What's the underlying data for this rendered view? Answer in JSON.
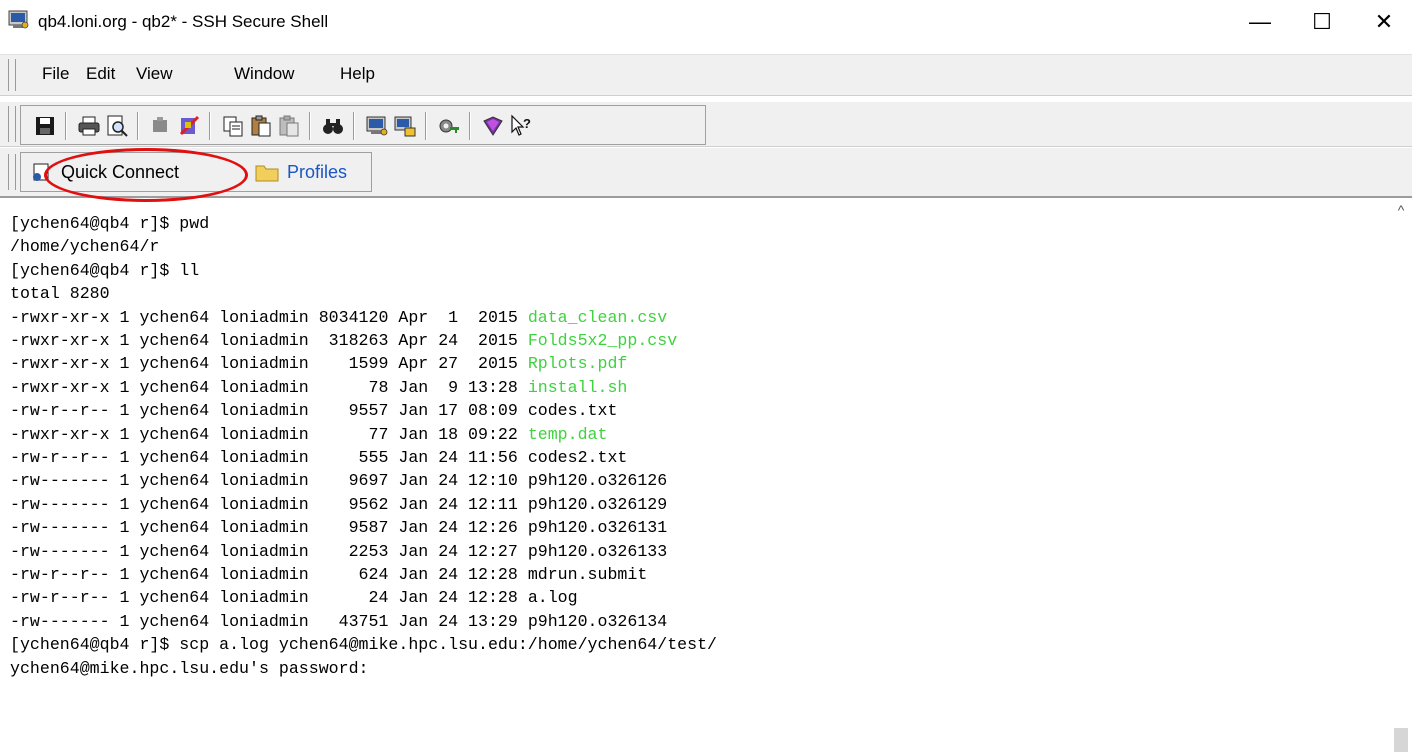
{
  "window": {
    "title": "qb4.loni.org - qb2* - SSH Secure Shell",
    "minimize_glyph": "—",
    "maximize_glyph": "☐",
    "close_glyph": "✕"
  },
  "menu": [
    "File",
    "Edit",
    "View",
    "Window",
    "Help"
  ],
  "toolbar_icons": [
    "save-icon",
    "print-icon",
    "print-preview-icon",
    "disconnect-icon",
    "settings-icon",
    "copy-icon",
    "paste-icon",
    "paste-disabled-icon",
    "find-icon",
    "new-terminal-icon",
    "new-file-transfer-icon",
    "key-icon",
    "help-book-icon",
    "whats-this-icon"
  ],
  "quickbar": {
    "quick_connect": "Quick Connect",
    "profiles": "Profiles"
  },
  "colors": {
    "highlight_ellipse": "#e01010",
    "executable_file": "#3fd23f",
    "profiles_link": "#1a57c4"
  },
  "terminal": {
    "lines": [
      {
        "text": "[ychen64@qb4 r]$ pwd"
      },
      {
        "text": "/home/ychen64/r"
      },
      {
        "text": "[ychen64@qb4 r]$ ll"
      },
      {
        "text": "total 8280"
      },
      {
        "text": "-rwxr-xr-x 1 ychen64 loniadmin 8034120 Apr  1  2015 ",
        "file": "data_clean.csv",
        "exec": true
      },
      {
        "text": "-rwxr-xr-x 1 ychen64 loniadmin  318263 Apr 24  2015 ",
        "file": "Folds5x2_pp.csv",
        "exec": true
      },
      {
        "text": "-rwxr-xr-x 1 ychen64 loniadmin    1599 Apr 27  2015 ",
        "file": "Rplots.pdf",
        "exec": true
      },
      {
        "text": "-rwxr-xr-x 1 ychen64 loniadmin      78 Jan  9 13:28 ",
        "file": "install.sh",
        "exec": true
      },
      {
        "text": "-rw-r--r-- 1 ychen64 loniadmin    9557 Jan 17 08:09 ",
        "file": "codes.txt",
        "exec": false
      },
      {
        "text": "-rwxr-xr-x 1 ychen64 loniadmin      77 Jan 18 09:22 ",
        "file": "temp.dat",
        "exec": true
      },
      {
        "text": "-rw-r--r-- 1 ychen64 loniadmin     555 Jan 24 11:56 ",
        "file": "codes2.txt",
        "exec": false
      },
      {
        "text": "-rw------- 1 ychen64 loniadmin    9697 Jan 24 12:10 ",
        "file": "p9h120.o326126",
        "exec": false
      },
      {
        "text": "-rw------- 1 ychen64 loniadmin    9562 Jan 24 12:11 ",
        "file": "p9h120.o326129",
        "exec": false
      },
      {
        "text": "-rw------- 1 ychen64 loniadmin    9587 Jan 24 12:26 ",
        "file": "p9h120.o326131",
        "exec": false
      },
      {
        "text": "-rw------- 1 ychen64 loniadmin    2253 Jan 24 12:27 ",
        "file": "p9h120.o326133",
        "exec": false
      },
      {
        "text": "-rw-r--r-- 1 ychen64 loniadmin     624 Jan 24 12:28 ",
        "file": "mdrun.submit",
        "exec": false
      },
      {
        "text": "-rw-r--r-- 1 ychen64 loniadmin      24 Jan 24 12:28 ",
        "file": "a.log",
        "exec": false
      },
      {
        "text": "-rw------- 1 ychen64 loniadmin   43751 Jan 24 13:29 ",
        "file": "p9h120.o326134",
        "exec": false
      },
      {
        "text": "[ychen64@qb4 r]$ scp a.log ychen64@mike.hpc.lsu.edu:/home/ychen64/test/"
      },
      {
        "text": "ychen64@mike.hpc.lsu.edu's password: "
      }
    ]
  }
}
